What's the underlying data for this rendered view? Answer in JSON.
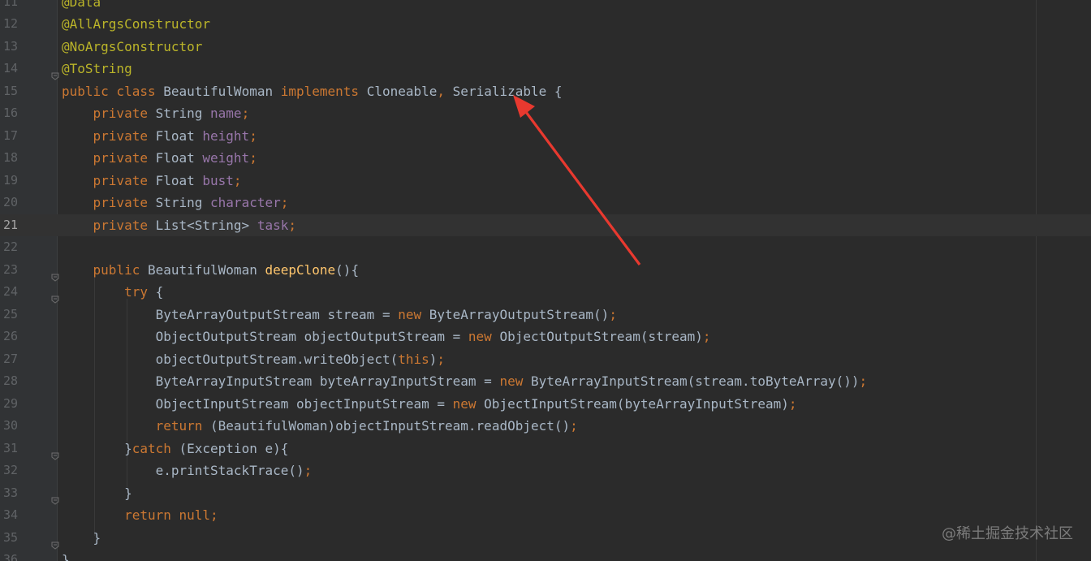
{
  "editor": {
    "current_line_number": "21",
    "lines": [
      {
        "num": "11",
        "tokens": [
          {
            "t": "@Data",
            "c": "annotation"
          }
        ]
      },
      {
        "num": "12",
        "tokens": [
          {
            "t": "@AllArgsConstructor",
            "c": "annotation"
          }
        ]
      },
      {
        "num": "13",
        "tokens": [
          {
            "t": "@NoArgsConstructor",
            "c": "annotation"
          }
        ]
      },
      {
        "num": "14",
        "tokens": [
          {
            "t": "@ToString",
            "c": "annotation"
          }
        ]
      },
      {
        "num": "15",
        "tokens": [
          {
            "t": "public class ",
            "c": "keyword"
          },
          {
            "t": "BeautifulWoman ",
            "c": "default"
          },
          {
            "t": "implements ",
            "c": "keyword"
          },
          {
            "t": "Cloneable",
            "c": "default"
          },
          {
            "t": ", ",
            "c": "punct"
          },
          {
            "t": "Serializable {",
            "c": "default"
          }
        ]
      },
      {
        "num": "16",
        "tokens": [
          {
            "t": "    private ",
            "c": "keyword"
          },
          {
            "t": "String ",
            "c": "default"
          },
          {
            "t": "name",
            "c": "field"
          },
          {
            "t": ";",
            "c": "punct"
          }
        ]
      },
      {
        "num": "17",
        "tokens": [
          {
            "t": "    private ",
            "c": "keyword"
          },
          {
            "t": "Float ",
            "c": "default"
          },
          {
            "t": "height",
            "c": "field"
          },
          {
            "t": ";",
            "c": "punct"
          }
        ]
      },
      {
        "num": "18",
        "tokens": [
          {
            "t": "    private ",
            "c": "keyword"
          },
          {
            "t": "Float ",
            "c": "default"
          },
          {
            "t": "weight",
            "c": "field"
          },
          {
            "t": ";",
            "c": "punct"
          }
        ]
      },
      {
        "num": "19",
        "tokens": [
          {
            "t": "    private ",
            "c": "keyword"
          },
          {
            "t": "Float ",
            "c": "default"
          },
          {
            "t": "bust",
            "c": "field"
          },
          {
            "t": ";",
            "c": "punct"
          }
        ]
      },
      {
        "num": "20",
        "tokens": [
          {
            "t": "    private ",
            "c": "keyword"
          },
          {
            "t": "String ",
            "c": "default"
          },
          {
            "t": "character",
            "c": "field"
          },
          {
            "t": ";",
            "c": "punct"
          }
        ]
      },
      {
        "num": "21",
        "tokens": [
          {
            "t": "    private ",
            "c": "keyword"
          },
          {
            "t": "List<String> ",
            "c": "default"
          },
          {
            "t": "task",
            "c": "field"
          },
          {
            "t": ";",
            "c": "punct"
          }
        ]
      },
      {
        "num": "22",
        "tokens": []
      },
      {
        "num": "23",
        "tokens": [
          {
            "t": "    public ",
            "c": "keyword"
          },
          {
            "t": "BeautifulWoman ",
            "c": "default"
          },
          {
            "t": "deepClone",
            "c": "method"
          },
          {
            "t": "(){",
            "c": "default"
          }
        ]
      },
      {
        "num": "24",
        "tokens": [
          {
            "t": "        try ",
            "c": "keyword"
          },
          {
            "t": "{",
            "c": "default"
          }
        ]
      },
      {
        "num": "25",
        "tokens": [
          {
            "t": "            ByteArrayOutputStream stream = ",
            "c": "default"
          },
          {
            "t": "new ",
            "c": "keyword"
          },
          {
            "t": "ByteArrayOutputStream()",
            "c": "default"
          },
          {
            "t": ";",
            "c": "punct"
          }
        ]
      },
      {
        "num": "26",
        "tokens": [
          {
            "t": "            ObjectOutputStream objectOutputStream = ",
            "c": "default"
          },
          {
            "t": "new ",
            "c": "keyword"
          },
          {
            "t": "ObjectOutputStream(stream)",
            "c": "default"
          },
          {
            "t": ";",
            "c": "punct"
          }
        ]
      },
      {
        "num": "27",
        "tokens": [
          {
            "t": "            objectOutputStream.writeObject(",
            "c": "default"
          },
          {
            "t": "this",
            "c": "keyword"
          },
          {
            "t": ")",
            "c": "default"
          },
          {
            "t": ";",
            "c": "punct"
          }
        ]
      },
      {
        "num": "28",
        "tokens": [
          {
            "t": "            ByteArrayInputStream byteArrayInputStream = ",
            "c": "default"
          },
          {
            "t": "new ",
            "c": "keyword"
          },
          {
            "t": "ByteArrayInputStream(stream.toByteArray())",
            "c": "default"
          },
          {
            "t": ";",
            "c": "punct"
          }
        ]
      },
      {
        "num": "29",
        "tokens": [
          {
            "t": "            ObjectInputStream objectInputStream = ",
            "c": "default"
          },
          {
            "t": "new ",
            "c": "keyword"
          },
          {
            "t": "ObjectInputStream(byteArrayInputStream)",
            "c": "default"
          },
          {
            "t": ";",
            "c": "punct"
          }
        ]
      },
      {
        "num": "30",
        "tokens": [
          {
            "t": "            return ",
            "c": "keyword"
          },
          {
            "t": "(BeautifulWoman)objectInputStream.readObject()",
            "c": "default"
          },
          {
            "t": ";",
            "c": "punct"
          }
        ]
      },
      {
        "num": "31",
        "tokens": [
          {
            "t": "        }",
            "c": "default"
          },
          {
            "t": "catch ",
            "c": "keyword"
          },
          {
            "t": "(Exception e){",
            "c": "default"
          }
        ]
      },
      {
        "num": "32",
        "tokens": [
          {
            "t": "            e.printStackTrace()",
            "c": "default"
          },
          {
            "t": ";",
            "c": "punct"
          }
        ]
      },
      {
        "num": "33",
        "tokens": [
          {
            "t": "        }",
            "c": "default"
          }
        ]
      },
      {
        "num": "34",
        "tokens": [
          {
            "t": "        return null",
            "c": "keyword"
          },
          {
            "t": ";",
            "c": "punct"
          }
        ]
      },
      {
        "num": "35",
        "tokens": [
          {
            "t": "    }",
            "c": "default"
          }
        ]
      },
      {
        "num": "36",
        "tokens": [
          {
            "t": "}",
            "c": "default"
          }
        ]
      }
    ]
  },
  "watermark": {
    "text": "@稀土掘金技术社区"
  },
  "colors": {
    "background": "#2b2b2b",
    "annotation": "#bbb529",
    "keyword": "#cc7832",
    "field": "#9876aa",
    "method": "#ffc66d",
    "text": "#a9b7c6",
    "arrow": "#e8392f"
  }
}
